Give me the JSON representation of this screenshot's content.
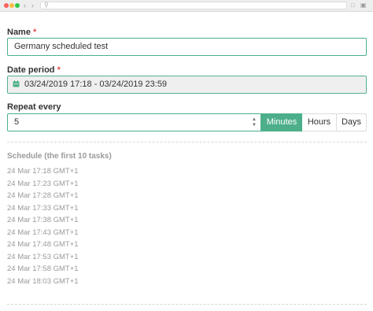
{
  "form": {
    "name_label": "Name",
    "name_value": "Germany scheduled test",
    "period_label": "Date period",
    "period_value": "03/24/2019 17:18 - 03/24/2019 23:59",
    "required_mark": "*",
    "repeat_label": "Repeat every",
    "repeat_value": "5",
    "units": [
      "Minutes",
      "Hours",
      "Days"
    ],
    "selected_unit": "Minutes",
    "accent_color": "#4caf8a"
  },
  "schedule": {
    "title": "Schedule (the first 10 tasks)",
    "items": [
      "24 Mar 17:18 GMT+1",
      "24 Mar 17:23 GMT+1",
      "24 Mar 17:28 GMT+1",
      "24 Mar 17:33 GMT+1",
      "24 Mar 17:38 GMT+1",
      "24 Mar 17:43 GMT+1",
      "24 Mar 17:48 GMT+1",
      "24 Mar 17:53 GMT+1",
      "24 Mar 17:58 GMT+1",
      "24 Mar 18:03 GMT+1"
    ]
  },
  "icons": {
    "calendar": "calendar-icon",
    "search": "search-icon"
  }
}
